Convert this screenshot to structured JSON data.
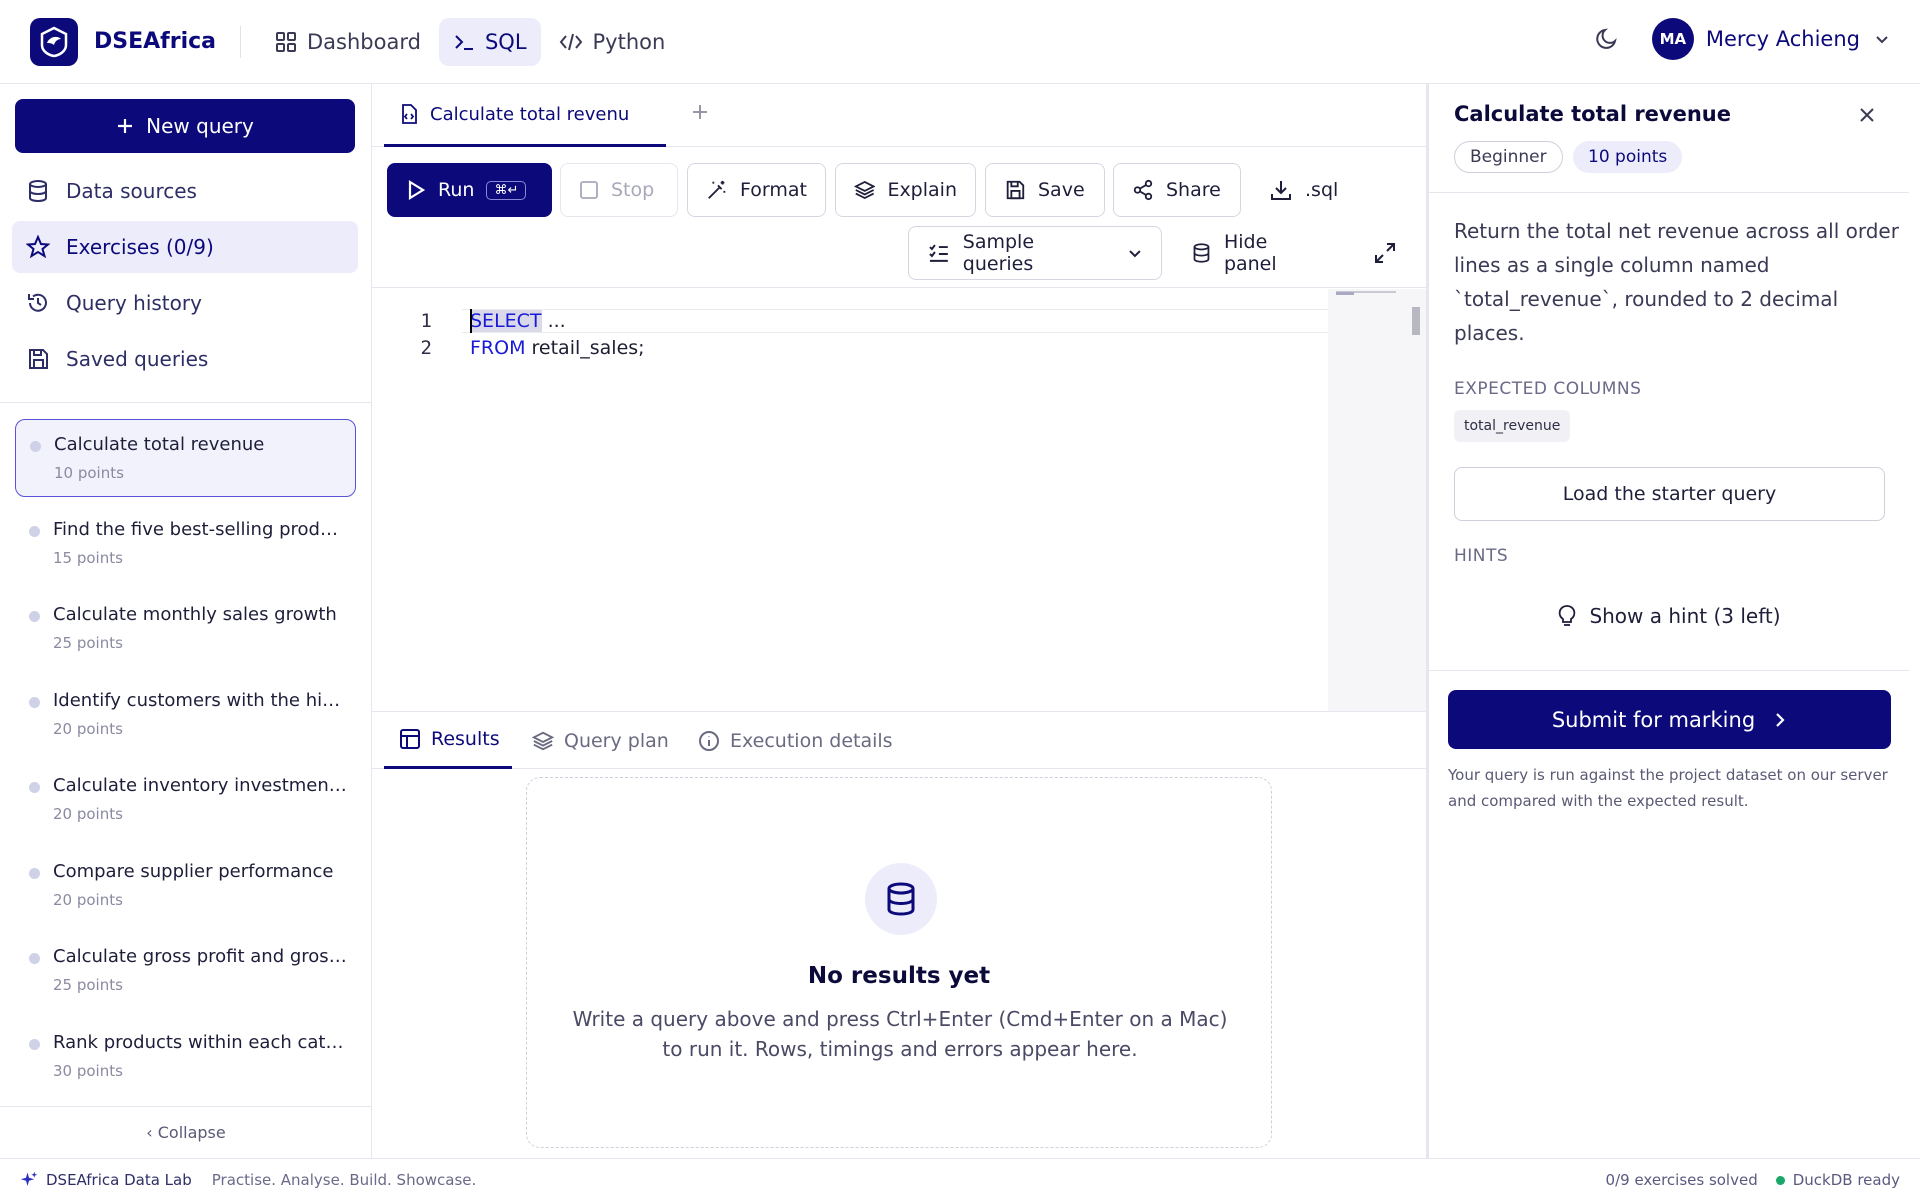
{
  "app": {
    "brand": "DSEAfrica"
  },
  "topnav": {
    "items": [
      {
        "label": "Dashboard"
      },
      {
        "label": "SQL"
      },
      {
        "label": "Python"
      }
    ]
  },
  "user": {
    "initials": "MA",
    "name": "Mercy Achieng"
  },
  "sidebar": {
    "new_query": "New query",
    "nav": [
      {
        "label": "Data sources"
      },
      {
        "label": "Exercises (0/9)"
      },
      {
        "label": "Query history"
      },
      {
        "label": "Saved queries"
      }
    ],
    "exercises": [
      {
        "title": "Calculate total revenue",
        "points": "10 points"
      },
      {
        "title": "Find the five best-selling products",
        "points": "15 points"
      },
      {
        "title": "Calculate monthly sales growth",
        "points": "25 points"
      },
      {
        "title": "Identify customers with the highe...",
        "points": "20 points"
      },
      {
        "title": "Calculate inventory investment b...",
        "points": "20 points"
      },
      {
        "title": "Compare supplier performance",
        "points": "20 points"
      },
      {
        "title": "Calculate gross profit and gross ...",
        "points": "25 points"
      },
      {
        "title": "Rank products within each categ...",
        "points": "30 points"
      }
    ],
    "collapse": "‹ Collapse"
  },
  "editor": {
    "tab_title": "Calculate total revenu",
    "toolbar": {
      "run": "Run",
      "run_kbd": "⌘↵",
      "stop": "Stop",
      "format": "Format",
      "explain": "Explain",
      "save": "Save",
      "share": "Share",
      "download": ".sql",
      "samples": "Sample queries",
      "hide_panel": "Hide panel"
    },
    "lines": [
      {
        "num": "1",
        "kw": "SELECT",
        "rest": " ..."
      },
      {
        "num": "2",
        "kw": "FROM",
        "rest": " retail_sales;"
      }
    ]
  },
  "results": {
    "tabs": [
      {
        "label": "Results"
      },
      {
        "label": "Query plan"
      },
      {
        "label": "Execution details"
      }
    ],
    "empty_title": "No results yet",
    "empty_text": "Write a query above and press Ctrl+Enter (Cmd+Enter on a Mac) to run it. Rows, timings and errors appear here."
  },
  "panel": {
    "title": "Calculate total revenue",
    "level": "Beginner",
    "points": "10 points",
    "description": "Return the total net revenue across all order lines as a single column named `total_revenue`, rounded to 2 decimal places.",
    "expected_label": "EXPECTED COLUMNS",
    "expected_columns": [
      "total_revenue"
    ],
    "starter": "Load the starter query",
    "hints_label": "HINTS",
    "hint_button": "Show a hint (3 left)",
    "submit": "Submit for marking",
    "note": "Your query is run against the project dataset on our server and compared with the expected result."
  },
  "footer": {
    "lab": "DSEAfrica Data Lab",
    "tagline": "Practise. Analyse. Build. Showcase.",
    "solved": "0/9 exercises solved",
    "status": "DuckDB ready"
  },
  "colors": {
    "accent": "#0c0a7a",
    "keyword": "#1a1ad6",
    "status_ok": "#1aa86a"
  }
}
